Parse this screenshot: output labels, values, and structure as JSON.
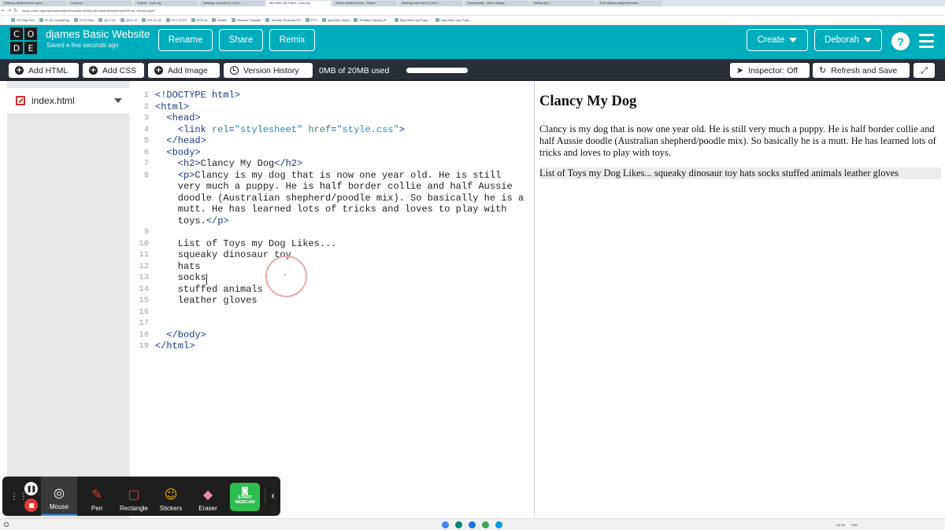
{
  "browser": {
    "tabs": [
      "Editing a Multiple choice quest…",
      "Code.org",
      "Projects - Code.org",
      "Headings and Lists #2 | Unit 2…",
      "New Web Lab Project - Code.org",
      "Search results for code - Flatiron",
      "Headings and Lists #2 | Unit 2…",
      "Screencastify - Video Hosting…",
      "Editing Quiz",
      "ECS syllabus assignment tools…"
    ],
    "url": "studio.code.org/projects/weblab/zf6cwnq2f-9016zzJAx-bdxnrW2b9iGn4eR2K0uh_9Xrdu4-bdn8",
    "bookmarks": [
      "CS Gap Gen",
      "22-23 Counseling",
      "ECS Folio",
      "Qtr 4 Gr",
      "Q4 6-10",
      "OR 22-23",
      "PLC 22-23",
      "ECS.ca",
      "Health",
      "Teacher Tutorials",
      "Teacher Renewal PD",
      "PTO",
      "QuizSets Tasks",
      "Problem Solving Pr…",
      "New Web Lab Proje…",
      "New Web Lab Proje…"
    ]
  },
  "header": {
    "logo_letters": [
      "C",
      "O",
      "D",
      "E"
    ],
    "project_name": "djames Basic Website",
    "saved_status": "Saved a few seconds ago",
    "rename_label": "Rename",
    "share_label": "Share",
    "remix_label": "Remix",
    "create_label": "Create",
    "user_label": "Deborah",
    "help_glyph": "?"
  },
  "toolbar": {
    "add_html_label": "Add HTML",
    "add_css_label": "Add CSS",
    "add_image_label": "Add Image",
    "version_history_label": "Version History",
    "storage_label": "0MB of 20MB used",
    "storage_used_fraction": 0,
    "inspector_label": "Inspector: Off",
    "refresh_label": "Refresh and Save"
  },
  "sidebar": {
    "active_file": "index.html"
  },
  "editor": {
    "lines": [
      {
        "n": "1",
        "text": "<!DOCTYPE html>"
      },
      {
        "n": "2",
        "text": "<html>"
      },
      {
        "n": "3",
        "text": "  <head>"
      },
      {
        "n": "4",
        "text": "    <link rel=\"stylesheet\" href=\"style.css\">"
      },
      {
        "n": "5",
        "text": "  </head>"
      },
      {
        "n": "6",
        "text": "  <body>"
      },
      {
        "n": "7",
        "text": "    <h2>Clancy My Dog</h2>"
      },
      {
        "n": "8",
        "text": "    <p>Clancy is my dog that is now one year old. He is still"
      },
      {
        "n": "",
        "text": "    very much a puppy. He is half border collie and half Aussie"
      },
      {
        "n": "",
        "text": "    doodle (Australian shepherd/poodle mix). So basically he is a"
      },
      {
        "n": "",
        "text": "    mutt. He has learned lots of tricks and loves to play with"
      },
      {
        "n": "",
        "text": "    toys.</p>"
      },
      {
        "n": "9",
        "text": ""
      },
      {
        "n": "10",
        "text": "    List of Toys my Dog Likes..."
      },
      {
        "n": "11",
        "text": "    squeaky dinosaur toy"
      },
      {
        "n": "12",
        "text": "    hats"
      },
      {
        "n": "13",
        "text": "    socks"
      },
      {
        "n": "14",
        "text": "    stuffed animals"
      },
      {
        "n": "15",
        "text": "    leather gloves"
      },
      {
        "n": "16",
        "text": ""
      },
      {
        "n": "17",
        "text": ""
      },
      {
        "n": "18",
        "text": "  </body>"
      },
      {
        "n": "19",
        "text": "</html>"
      }
    ]
  },
  "preview": {
    "heading": "Clancy My Dog",
    "paragraph": "Clancy is my dog that is now one year old. He is still very much a puppy. He is half border collie and half Aussie doodle (Australian shepherd/poodle mix). So basically he is a mutt. He has learned lots of tricks and loves to play with toys.",
    "list_text": "List of Toys my Dog Likes... squeaky dinosaur toy hats socks stuffed animals leather gloves"
  },
  "dock": {
    "mouse_label": "Mouse",
    "pen_label": "Pen",
    "rectangle_label": "Rectangle",
    "stickers_label": "Stickers",
    "eraser_label": "Eraser",
    "webcam_label_1": "START",
    "webcam_label_2": "WEBCAM"
  },
  "shelf": {
    "date": "Jul 26",
    "time": "9:05"
  },
  "colors": {
    "header_teal": "#00adbc",
    "toolbar_dark": "#292f36",
    "webcam_green": "#2ebd50",
    "stop_red": "#e53935"
  },
  "icons": [
    "code-org-logo",
    "caret-down-icon",
    "help-icon",
    "hamburger-menu-icon",
    "plus-circle-icon",
    "clock-icon",
    "cursor-arrow-icon",
    "refresh-icon",
    "fullscreen-icon",
    "pencil-file-icon",
    "pause-icon",
    "stop-icon",
    "mouse-icon",
    "pen-icon",
    "rectangle-icon",
    "sticker-icon",
    "eraser-icon",
    "webcam-icon",
    "chevron-left-icon"
  ]
}
